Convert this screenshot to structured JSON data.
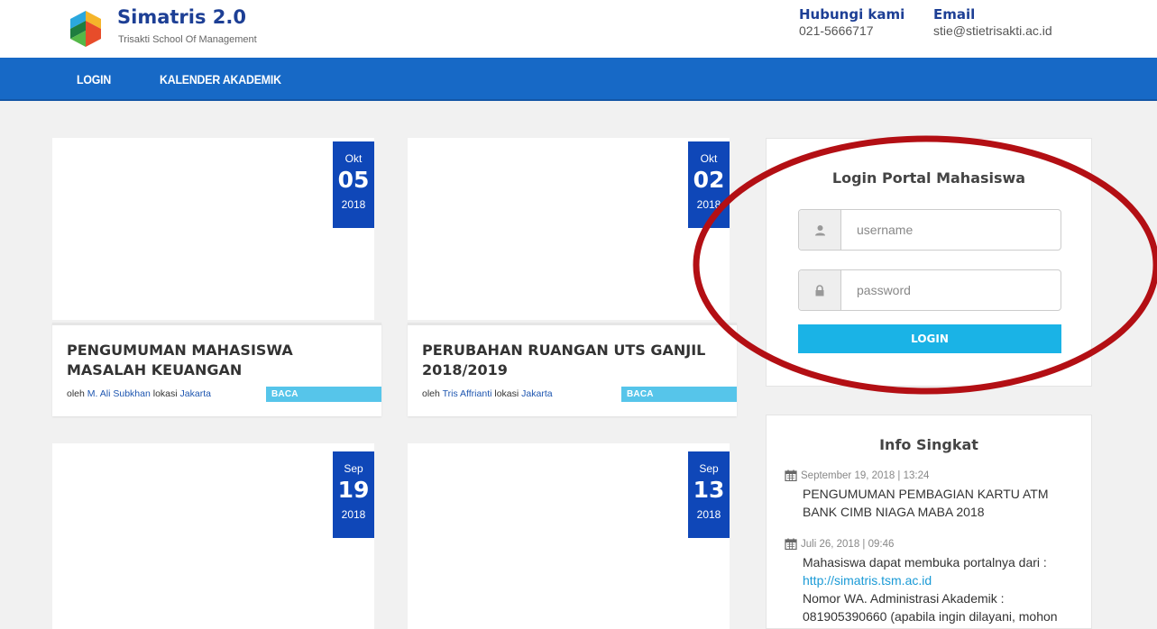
{
  "header": {
    "brand_title": "Simatris 2.0",
    "brand_subtitle": "Trisakti School Of Management",
    "contact_label": "Hubungi kami",
    "contact_phone": "021-5666717",
    "email_label": "Email",
    "email_value": "stie@stietrisakti.ac.id"
  },
  "nav": {
    "items": [
      {
        "label": "LOGIN"
      },
      {
        "label": "KALENDER AKADEMIK"
      }
    ]
  },
  "news": [
    {
      "month": "Okt",
      "day": "05",
      "year": "2018",
      "title": "PENGUMUMAN MAHASISWA MASALAH KEUANGAN",
      "by_prefix": "oleh",
      "author": "M. Ali Subkhan",
      "loc_prefix": "lokasi",
      "location": "Jakarta",
      "read_more": "BACA SELENGKAPNYA"
    },
    {
      "month": "Okt",
      "day": "02",
      "year": "2018",
      "title": "PERUBAHAN RUANGAN UTS GANJIL 2018/2019",
      "by_prefix": "oleh",
      "author": "Tris Affrianti",
      "loc_prefix": "lokasi",
      "location": "Jakarta",
      "read_more": "BACA SELENGKAPNYA"
    },
    {
      "month": "Sep",
      "day": "19",
      "year": "2018"
    },
    {
      "month": "Sep",
      "day": "13",
      "year": "2018"
    }
  ],
  "login": {
    "title": "Login Portal Mahasiswa",
    "username_placeholder": "username",
    "password_placeholder": "password",
    "button_label": "LOGIN"
  },
  "info": {
    "title": "Info Singkat",
    "items": [
      {
        "date": "September 19, 2018 | 13:24",
        "text": "PENGUMUMAN PEMBAGIAN KARTU ATM BANK CIMB NIAGA MABA 2018"
      },
      {
        "date": "Juli 26, 2018 | 09:46",
        "line1": "Mahasiswa dapat membuka portalnya dari :",
        "link": "http://simatris.tsm.ac.id",
        "line2": "Nomor WA. Administrasi Akademik :",
        "line3": "081905390660 (apabila ingin dilayani, mohon"
      }
    ]
  },
  "colors": {
    "nav": "#1769c6",
    "date_badge": "#0f47b8",
    "read_more": "#56c5ea",
    "login_button": "#1ab3e6",
    "annotation": "#b30f14",
    "brand": "#1d3f95"
  }
}
